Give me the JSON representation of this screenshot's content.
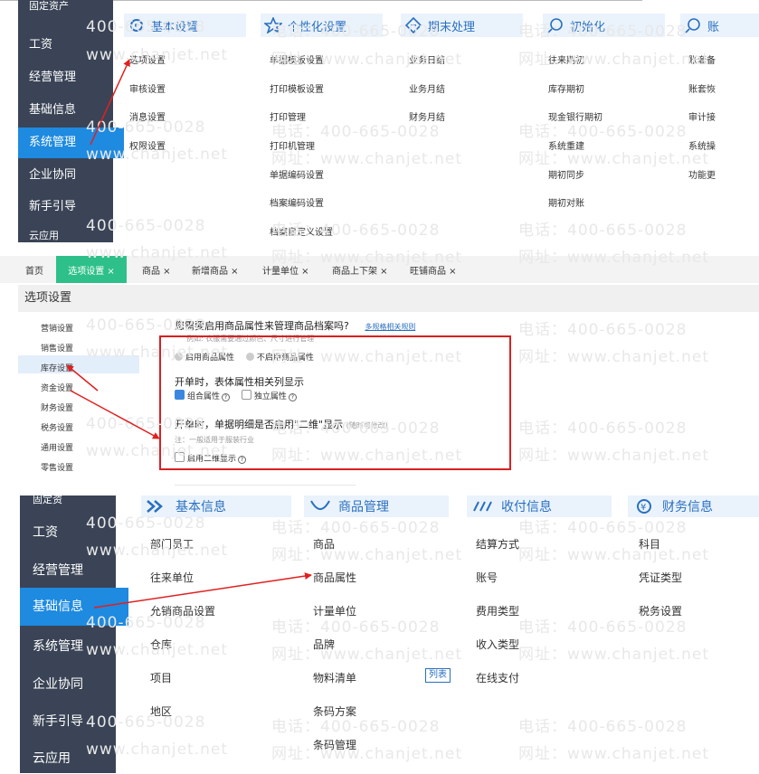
{
  "panel1": {
    "sidebar": [
      {
        "label": "固定资产",
        "active": false
      },
      {
        "label": "工资",
        "active": false
      },
      {
        "label": "经营管理",
        "active": false
      },
      {
        "label": "基础信息",
        "active": false
      },
      {
        "label": "系统管理",
        "active": true
      },
      {
        "label": "企业协同",
        "active": false
      },
      {
        "label": "新手引导",
        "active": false
      },
      {
        "label": "云应用",
        "active": false
      }
    ],
    "categories": [
      {
        "label": "基本设置",
        "icon": "settings-icon",
        "items": [
          "选项设置",
          "审核设置",
          "消息设置",
          "权限设置"
        ]
      },
      {
        "label": "个性化设置",
        "icon": "personalize-icon",
        "items": [
          "单据模板设置",
          "打印模板设置",
          "打印管理",
          "打印机管理",
          "单据编码设置",
          "档案编码设置",
          "档案自定义设置"
        ]
      },
      {
        "label": "期末处理",
        "icon": "period-end-icon",
        "items": [
          "业务日结",
          "业务月结",
          "财务月结"
        ]
      },
      {
        "label": "初始化",
        "icon": "init-icon",
        "items": [
          "往来期初",
          "库存期初",
          "现金银行期初",
          "系统重建",
          "期初同步",
          "期初对账"
        ]
      },
      {
        "label": "账",
        "icon": "account-icon",
        "items": [
          "账套备",
          "账套恢",
          "审计接",
          "系统操",
          "功能更"
        ]
      }
    ]
  },
  "panel2": {
    "tabs": [
      {
        "label": "首页",
        "active": false
      },
      {
        "label": "选项设置 ×",
        "active": true
      },
      {
        "label": "商品 ×",
        "active": false
      },
      {
        "label": "新增商品 ×",
        "active": false
      },
      {
        "label": "计量单位 ×",
        "active": false
      },
      {
        "label": "商品上下架 ×",
        "active": false
      },
      {
        "label": "旺铺商品 ×",
        "active": false
      }
    ],
    "page_title": "选项设置",
    "subnav": [
      "营销设置",
      "销售设置",
      "库存设置",
      "资金设置",
      "财务设置",
      "税务设置",
      "通用设置",
      "零售设置"
    ],
    "subnav_active": "库存设置",
    "question": "您需要启用商品属性来管理商品档案吗?",
    "question_link": "多规格相关规则",
    "example": "例如: 衣服需要通过颜色、尺寸进行管理",
    "radio_on": "启用商品属性",
    "radio_off": "不启用商品属性",
    "heading1": "开单时，表体属性相关列显示",
    "check_combo": "组合属性",
    "check_indep": "独立属性",
    "heading2": "开单时，单据明细是否启用\"二维\"显示",
    "heading2_note": "(随时可修改)",
    "note": "注：一般适用于服装行业",
    "check_2d": "启用二维显示"
  },
  "panel3": {
    "sidebar": [
      {
        "label": "固定资",
        "active": false
      },
      {
        "label": "工资",
        "active": false
      },
      {
        "label": "经营管理",
        "active": false
      },
      {
        "label": "基础信息",
        "active": true
      },
      {
        "label": "系统管理",
        "active": false
      },
      {
        "label": "企业协同",
        "active": false
      },
      {
        "label": "新手引导",
        "active": false
      },
      {
        "label": "云应用",
        "active": false
      }
    ],
    "categories": [
      {
        "label": "基本信息",
        "icon": "basic-info-icon",
        "items": [
          "部门员工",
          "往来单位",
          "允销商品设置",
          "仓库",
          "项目",
          "地区"
        ]
      },
      {
        "label": "商品管理",
        "icon": "product-mgmt-icon",
        "items": [
          "商品",
          "商品属性",
          "计量单位",
          "品牌",
          "物料清单",
          "条码方案",
          "条码管理"
        ]
      },
      {
        "label": "收付信息",
        "icon": "payment-info-icon",
        "items": [
          "结算方式",
          "账号",
          "费用类型",
          "收入类型",
          "在线支付"
        ]
      },
      {
        "label": "财务信息",
        "icon": "finance-info-icon",
        "items": [
          "科目",
          "凭证类型",
          "税务设置"
        ]
      }
    ],
    "list_badge": "列表"
  },
  "watermark": {
    "phone": "电话：400-665-0028",
    "site": "网址：www.chanjet.net",
    "phone_short": "400-665-0028",
    "site_short": "www.chanjet.net"
  },
  "colors": {
    "sidebar": "#3a4456",
    "active": "#1e8ae0",
    "accent": "#2a6fc0",
    "arrow": "#e02020",
    "tab_active": "#2ec08a"
  }
}
